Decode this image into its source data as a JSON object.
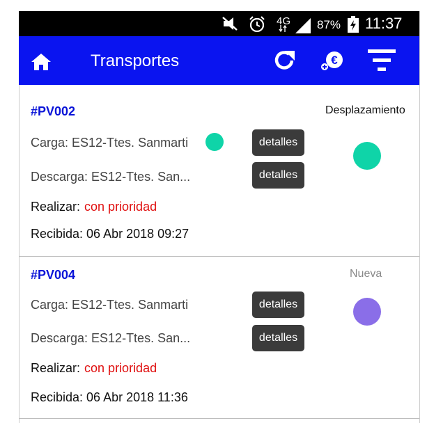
{
  "status_bar": {
    "network": "4G",
    "battery": "87%",
    "time": "11:37"
  },
  "app_bar": {
    "title": "Transportes",
    "icons": [
      "home-icon",
      "refresh-icon",
      "euro-price-icon",
      "filter-icon"
    ]
  },
  "transports": [
    {
      "id": "#PV002",
      "status": "Desplazamiento",
      "status_color": "#111111",
      "status_dot_color": "#0fd4a8",
      "carga": "Carga: ES12-Ttes. Sanmarti",
      "carga_dot_color": "#0fd4a8",
      "descarga": "Descarga: ES12-Ttes. San...",
      "details_label": "detalles",
      "realizar_label": "Realizar:",
      "realizar_value": "con prioridad",
      "recibida": "Recibida:  06 Abr 2018 09:27"
    },
    {
      "id": "#PV004",
      "status": "Nueva",
      "status_color": "#888888",
      "status_dot_color": "#8a6ee8",
      "carga": "Carga: ES12-Ttes. Sanmarti",
      "descarga": "Descarga: ES12-Ttes. San...",
      "details_label": "detalles",
      "realizar_label": "Realizar:",
      "realizar_value": "con prioridad",
      "recibida": "Recibida:  06 Abr 2018 11:36"
    }
  ]
}
